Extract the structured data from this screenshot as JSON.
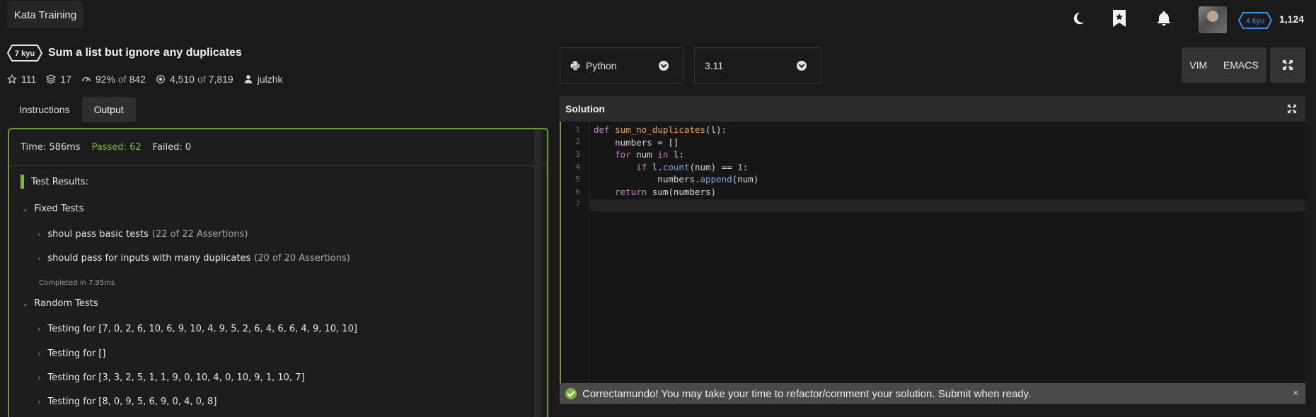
{
  "topbar": {
    "tab_label": "Kata Training",
    "icons": [
      "moon-icon",
      "bookmark-star-icon",
      "bell-icon"
    ],
    "rank": "4 kyu",
    "honor": "1,124"
  },
  "kata": {
    "kyu": "7 kyu",
    "title": "Sum a list but ignore any duplicates",
    "stats": {
      "stars": "111",
      "collections": "17",
      "satisfaction_pct": "92%",
      "satisfaction_of": "of",
      "satisfaction_votes": "842",
      "completed": "4,510",
      "completed_of": "of",
      "attempts": "7,819",
      "author": "julzhk"
    }
  },
  "tabs": [
    {
      "label": "Instructions",
      "active": false
    },
    {
      "label": "Output",
      "active": true
    }
  ],
  "output": {
    "time": "Time: 586ms",
    "passed": "Passed: 62",
    "failed": "Failed: 0",
    "results_title": "Test Results:",
    "fixed_group": "Fixed Tests",
    "fixed_items": [
      {
        "label": "shoul pass basic tests",
        "assertions": "(22 of 22 Assertions)"
      },
      {
        "label": "should pass for inputs with many duplicates",
        "assertions": "(20 of 20 Assertions)"
      }
    ],
    "completed": "Completed in 7.95ms",
    "random_group": "Random Tests",
    "random_items": [
      "Testing for [7, 0, 2, 6, 10, 6, 9, 10, 4, 9, 5, 2, 6, 4, 6, 6, 4, 9, 10, 10]",
      "Testing for []",
      "Testing for [3, 3, 2, 5, 1, 1, 9, 0, 10, 4, 0, 10, 9, 1, 10, 7]",
      "Testing for [8, 0, 9, 5, 6, 9, 0, 4, 0, 8]"
    ]
  },
  "editor": {
    "language": "Python",
    "version": "3.11",
    "modes": [
      "VIM",
      "EMACS"
    ],
    "panel_title": "Solution",
    "line_numbers": [
      "1",
      "2",
      "3",
      "4",
      "5",
      "6",
      "7"
    ],
    "success_message": "Correctamundo! You may take your time to refactor/comment your solution. Submit when ready.",
    "close_glyph": "×"
  },
  "colors": {
    "accent_green": "#7fb543",
    "border_green": "#6e9c37",
    "rank_blue": "#3d8fe0"
  }
}
